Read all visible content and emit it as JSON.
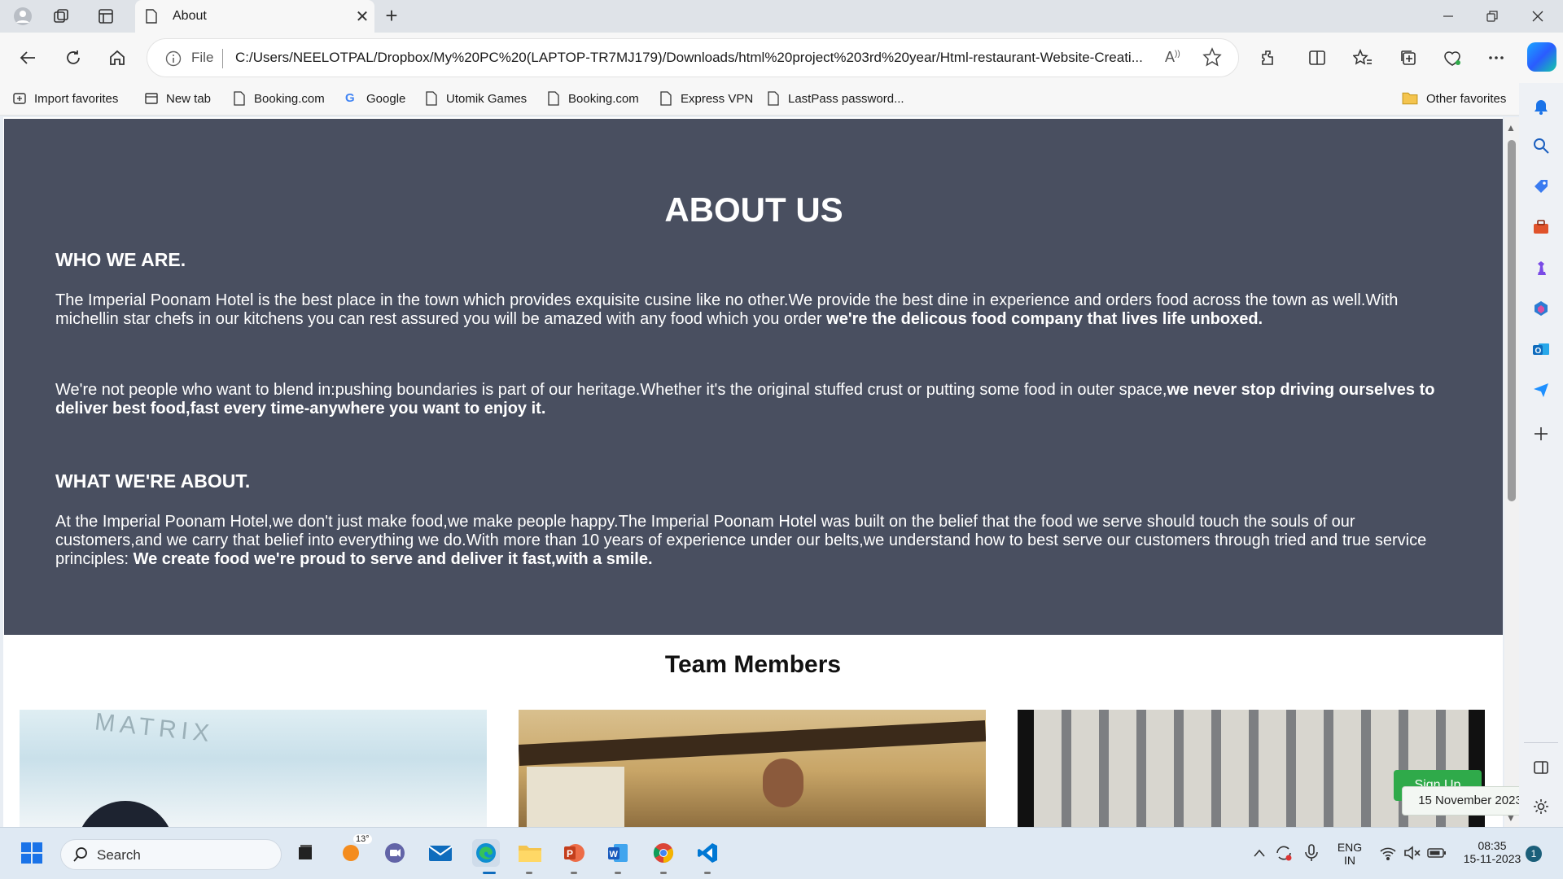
{
  "browser": {
    "tab_title": "About",
    "omnibox": {
      "scheme_label": "File",
      "url": "C:/Users/NEELOTPAL/Dropbox/My%20PC%20(LAPTOP-TR7MJ179)/Downloads/html%20project%203rd%20year/Html-restaurant-Website-Creati..."
    },
    "favorites": [
      {
        "label": "Import favorites",
        "icon": "import-icon"
      },
      {
        "label": "New tab",
        "icon": "newtab-icon"
      },
      {
        "label": "Booking.com",
        "icon": "page-icon"
      },
      {
        "label": "Google",
        "icon": "google-icon"
      },
      {
        "label": "Utomik Games",
        "icon": "page-icon"
      },
      {
        "label": "Booking.com",
        "icon": "page-icon"
      },
      {
        "label": "Express VPN",
        "icon": "page-icon"
      },
      {
        "label": "LastPass password...",
        "icon": "page-icon"
      }
    ],
    "other_favorites": "Other favorites"
  },
  "page": {
    "heading": "ABOUT US",
    "who_heading": "WHO WE ARE.",
    "para1_text": "The Imperial Poonam Hotel is the best place in the town which provides exquisite cusine like no other.We provide the best dine in experience and orders food across the town as well.With michellin star chefs in our kitchens you can rest assured you will be amazed with any food which you order ",
    "para1_bold": "we're the delicous food company that lives life unboxed.",
    "para2_text": "We're not people who want to blend in:pushing boundaries is part of our heritage.Whether it's the original stuffed crust or putting some food in outer space,",
    "para2_bold": "we never stop driving ourselves to deliver best food,fast every time-anywhere you want to enjoy it.",
    "what_heading": "WHAT WE'RE ABOUT.",
    "para3_text": "At the Imperial Poonam Hotel,we don't just make food,we make people happy.The Imperial Poonam Hotel was built on the belief that the food we serve should touch the souls of our customers,and we carry that belief into everything we do.With more than 10 years of experience under our belts,we understand how to best serve our customers through tried and true service principles: ",
    "para3_bold": "We create food we're proud to serve and deliver it fast,with a smile.",
    "team_heading": "Team Members",
    "card1_sign_text": "MATRIX",
    "signup_label": "Sign Up"
  },
  "tooltip": {
    "date": "15 November 2023"
  },
  "taskbar": {
    "search_placeholder": "Search",
    "weather_temp": "13°",
    "lang_top": "ENG",
    "lang_bottom": "IN",
    "time": "08:35",
    "date": "15-11-2023",
    "notification_count": "1"
  },
  "colors": {
    "about_bg": "#494f60",
    "signup_green": "#2faa4a",
    "edge_blue": "#0f6cbd"
  }
}
